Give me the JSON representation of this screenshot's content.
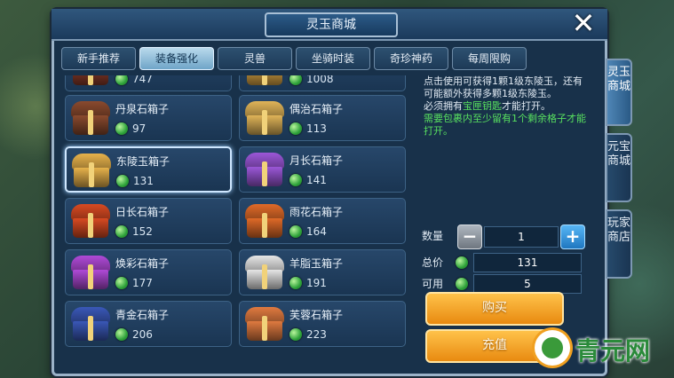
{
  "window": {
    "title": "灵玉商城",
    "close_glyph": "✕"
  },
  "tabs": [
    {
      "label": "新手推荐",
      "active": false
    },
    {
      "label": "装备强化",
      "active": true
    },
    {
      "label": "灵兽",
      "active": false
    },
    {
      "label": "坐骑时装",
      "active": false
    },
    {
      "label": "奇珍神药",
      "active": false
    },
    {
      "label": "每周限购",
      "active": false
    }
  ],
  "items": [
    {
      "name": "",
      "price": "747",
      "color": "#8a3b2a",
      "selected": false
    },
    {
      "name": "",
      "price": "1008",
      "color": "#d8a444",
      "selected": false
    },
    {
      "name": "丹泉石箱子",
      "price": "97",
      "color": "#8a4a2e",
      "selected": false
    },
    {
      "name": "偶治石箱子",
      "price": "113",
      "color": "#e0b458",
      "selected": false
    },
    {
      "name": "东陵玉箱子",
      "price": "131",
      "color": "#e7b24b",
      "selected": true
    },
    {
      "name": "月长石箱子",
      "price": "141",
      "color": "#9b57d8",
      "selected": false
    },
    {
      "name": "日长石箱子",
      "price": "152",
      "color": "#d84a22",
      "selected": false
    },
    {
      "name": "雨花石箱子",
      "price": "164",
      "color": "#e06a28",
      "selected": false
    },
    {
      "name": "焕彩石箱子",
      "price": "177",
      "color": "#b04ad8",
      "selected": false
    },
    {
      "name": "羊脂玉箱子",
      "price": "191",
      "color": "#e6e6e6",
      "selected": false
    },
    {
      "name": "青金石箱子",
      "price": "206",
      "color": "#3a58b8",
      "selected": false
    },
    {
      "name": "芙蓉石箱子",
      "price": "223",
      "color": "#e07a40",
      "selected": false
    }
  ],
  "description": {
    "line1": "点击使用可获得1颗1级东陵玉，还有可能额外获得多颗1级东陵玉。",
    "line2_prefix": "必须拥有",
    "line2_key": "宝匣钥匙",
    "line2_suffix": "才能打开。",
    "line3": "需要包裹内至少留有1个剩余格子才能打开。"
  },
  "purchase": {
    "quantity_label": "数量",
    "quantity_value": "1",
    "total_label": "总价",
    "total_value": "131",
    "available_label": "可用",
    "available_value": "5",
    "minus_glyph": "−",
    "plus_glyph": "+",
    "buy_label": "购买",
    "recharge_label": "充值"
  },
  "side_tabs": [
    {
      "label": "灵玉商城",
      "active": true
    },
    {
      "label": "元宝商城",
      "active": false
    },
    {
      "label": "玩家商店",
      "active": false
    }
  ],
  "background": {
    "left_label": "",
    "right_stat": ""
  },
  "watermark": {
    "text": "青元网"
  },
  "colors": {
    "active_tab": "#8cbddc",
    "orange_button": "#f2a22a",
    "jade_green": "#2ea23a",
    "highlight_text": "#58e05f"
  }
}
